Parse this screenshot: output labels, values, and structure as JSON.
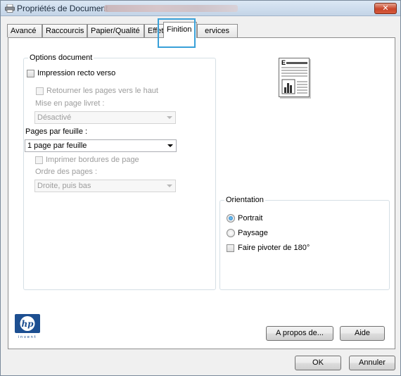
{
  "window": {
    "title": "Propriétés de Document",
    "close_label": "✕"
  },
  "tabs": [
    {
      "label": "Avancé"
    },
    {
      "label": "Raccourcis"
    },
    {
      "label": "Papier/Qualité"
    },
    {
      "label": "Effet"
    },
    {
      "label": "Finition"
    },
    {
      "label": "ervices"
    }
  ],
  "options_document": {
    "legend": "Options document",
    "duplex_label": "Impression recto verso",
    "flip_pages_label": "Retourner les pages vers le haut",
    "booklet_label": "Mise en page livret :",
    "booklet_value": "Désactivé",
    "pages_per_sheet_label": "Pages par feuille :",
    "pages_per_sheet_value": "1 page par feuille",
    "print_borders_label": "Imprimer bordures de page",
    "page_order_label": "Ordre des pages :",
    "page_order_value": "Droite, puis bas"
  },
  "orientation": {
    "legend": "Orientation",
    "portrait_label": "Portrait",
    "landscape_label": "Paysage",
    "rotate_label": "Faire pivoter de 180°"
  },
  "preview": {
    "letter": "E"
  },
  "buttons": {
    "about": "A propos de...",
    "help": "Aide",
    "ok": "OK",
    "cancel": "Annuler"
  },
  "brand": {
    "logo_text": "hp",
    "tagline": "invent",
    "logo_color": "#1d4f91",
    "highlight_color": "#38a0d8"
  }
}
